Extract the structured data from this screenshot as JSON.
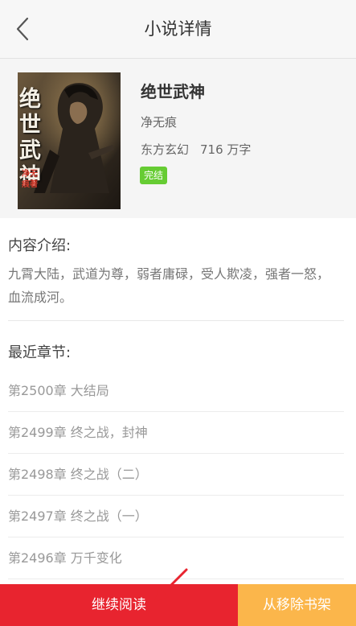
{
  "header": {
    "title": "小说详情",
    "back_icon": "chevron-left-icon"
  },
  "book": {
    "title": "绝世武神",
    "cover_text": "绝世武神",
    "cover_author_text": "净无痕著",
    "author": "净无痕",
    "category": "东方玄幻",
    "word_count": "716 万字",
    "status": "完结",
    "status_color": "#66cc33"
  },
  "intro": {
    "heading": "内容介绍:",
    "text": "九霄大陆，武道为尊，弱者庸碌，受人欺凌，强者一怒，血流成河。"
  },
  "chapters": {
    "heading": "最近章节:",
    "items": [
      {
        "label": "第2500章 大结局"
      },
      {
        "label": "第2499章 终之战，封神"
      },
      {
        "label": "第2498章 终之战（二）"
      },
      {
        "label": "第2497章 终之战（一）"
      },
      {
        "label": "第2496章 万千变化"
      }
    ]
  },
  "actions": {
    "continue_label": "继续阅读",
    "remove_label": "从移除书架",
    "continue_color": "#e8242f",
    "remove_color": "#fbb64b"
  }
}
